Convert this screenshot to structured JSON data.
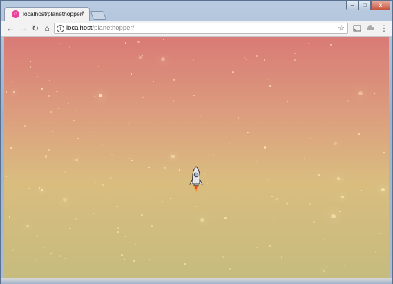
{
  "browser": {
    "tab": {
      "title": "localhost/planethopper/",
      "favicon": "smiley-favicon-icon",
      "favicon_color": "#e8409b",
      "close_label": "×"
    },
    "window_controls": {
      "minimize": "–",
      "maximize": "□",
      "close": "x"
    },
    "toolbar": {
      "back": "←",
      "forward": "→",
      "reload": "↻",
      "home": "⌂",
      "url_host": "localhost",
      "url_path": "/planethopper/",
      "bookmark": "☆",
      "menu": "⋮"
    }
  },
  "game": {
    "background_top_color": "#d97a76",
    "background_bottom_color": "#c6bb7e",
    "player": "rocket-icon"
  }
}
